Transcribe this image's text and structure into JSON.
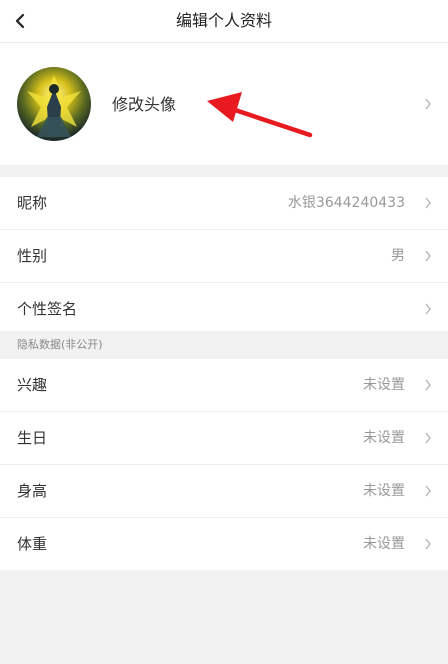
{
  "header": {
    "title": "编辑个人资料"
  },
  "avatar": {
    "label": "修改头像"
  },
  "profile": [
    {
      "label": "昵称",
      "value": "水银3644240433"
    },
    {
      "label": "性别",
      "value": "男"
    },
    {
      "label": "个性签名",
      "value": ""
    }
  ],
  "privacy": {
    "header": "隐私数据(非公开)",
    "items": [
      {
        "label": "兴趣",
        "value": "未设置"
      },
      {
        "label": "生日",
        "value": "未设置"
      },
      {
        "label": "身高",
        "value": "未设置"
      },
      {
        "label": "体重",
        "value": "未设置"
      }
    ]
  },
  "colors": {
    "annotation_arrow": "#e8191f",
    "background": "#f2f2f2",
    "value_text": "#999999"
  }
}
